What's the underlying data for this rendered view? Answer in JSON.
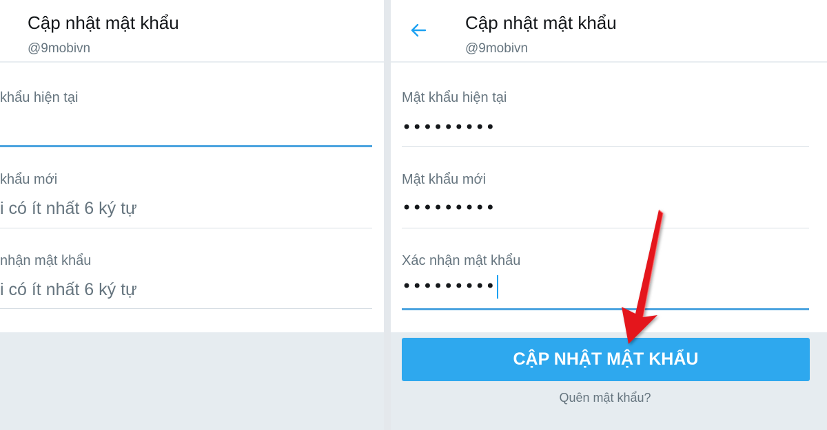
{
  "left_panel": {
    "header": {
      "title": "Cập nhật mật khẩu",
      "subtitle": "@9mobivn"
    },
    "fields": [
      {
        "label": "khẩu hiện tại",
        "value": ""
      },
      {
        "label": "khẩu mới",
        "value": "i có ít nhất 6 ký tự"
      },
      {
        "label": "nhận mật khẩu",
        "value": "i có ít nhất 6 ký tự"
      }
    ]
  },
  "right_panel": {
    "header": {
      "title": "Cập nhật mật khẩu",
      "subtitle": "@9mobivn",
      "back_icon": "arrow-left-icon"
    },
    "fields": [
      {
        "label": "Mật khẩu hiện tại",
        "value": "•••••••••"
      },
      {
        "label": "Mật khẩu mới",
        "value": "•••••••••"
      },
      {
        "label": "Xác nhận mật khẩu",
        "value": "•••••••••"
      }
    ],
    "submit_label": "CẬP NHẬT MẬT KHẨU",
    "forgot_link": "Quên mật khẩu?"
  },
  "annotation": {
    "icon": "red-arrow-icon",
    "color": "#e4161b"
  },
  "colors": {
    "accent": "#1da1f2",
    "button": "#2ea8ee",
    "muted_text": "#66757f"
  }
}
